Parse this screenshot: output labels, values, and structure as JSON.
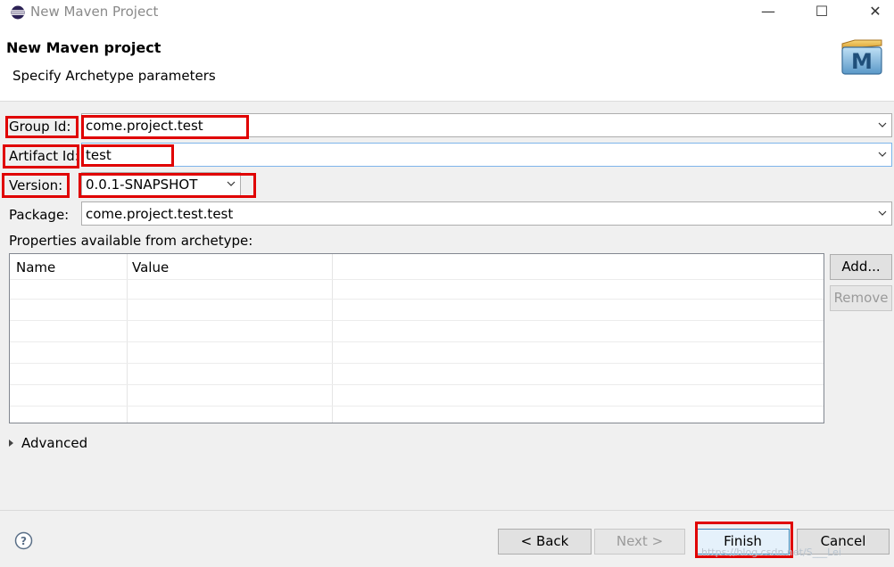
{
  "window": {
    "title": "New Maven Project",
    "minimize_glyph": "—",
    "maximize_glyph": "☐",
    "close_glyph": "✕"
  },
  "header": {
    "title": "New Maven project",
    "subtitle": "Specify Archetype parameters",
    "logo_letter": "M"
  },
  "form": {
    "group_id": {
      "label": "Group Id:",
      "value": "come.project.test"
    },
    "artifact_id": {
      "label": "Artifact Id:",
      "value": "test"
    },
    "version": {
      "label": "Version:",
      "value": "0.0.1-SNAPSHOT"
    },
    "package": {
      "label": "Package:",
      "value": "come.project.test.test"
    }
  },
  "properties": {
    "label": "Properties available from archetype:",
    "columns": [
      "Name",
      "Value"
    ],
    "rows": []
  },
  "side_buttons": {
    "add": "Add...",
    "remove": "Remove"
  },
  "advanced": {
    "label": "Advanced"
  },
  "footer": {
    "back": "< Back",
    "next": "Next >",
    "finish": "Finish",
    "cancel": "Cancel"
  },
  "watermark": "https://blog.csdn.net/S___Lei",
  "icons": {
    "app": "eclipse-icon",
    "help": "help-icon",
    "dropdown": "chevron-down-icon",
    "expand": "triangle-right-icon",
    "logo": "maven-logo-icon"
  },
  "colors": {
    "highlight_box": "#e00000",
    "focus_border": "#7eb4ea",
    "default_button_border": "#3c7fb1"
  }
}
